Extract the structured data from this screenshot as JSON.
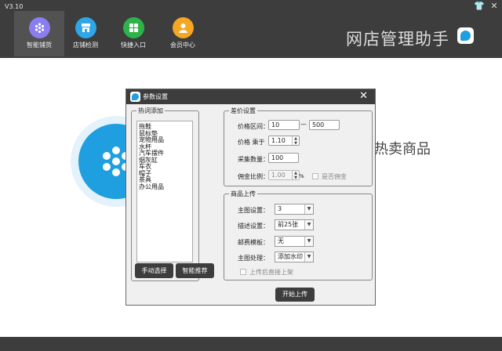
{
  "app": {
    "version": "V3.10",
    "brand_title": "网店管理助手",
    "colors": {
      "dark_bar": "#3d3d3d",
      "accent_blue": "#1f9ee0"
    }
  },
  "nav": {
    "items": [
      {
        "label": "智能铺货",
        "icon": "hexagon-dots-icon",
        "color": "#8a7df0"
      },
      {
        "label": "店铺检测",
        "icon": "store-icon",
        "color": "#2ea6e8"
      },
      {
        "label": "快捷入口",
        "icon": "grid-icon",
        "color": "#2db34a"
      },
      {
        "label": "会员中心",
        "icon": "user-icon",
        "color": "#f5a623"
      }
    ]
  },
  "background": {
    "headline": "热卖商品"
  },
  "dialog": {
    "title": "参数设置",
    "hot_words": {
      "title": "热词添加",
      "items": [
        "拖鞋",
        "鼠标垫",
        "宠物用品",
        "水杯",
        "汽车摆件",
        "烟灰缸",
        "车衣",
        "帽子",
        "茶具",
        "办公用品"
      ],
      "manual_button": "手动选择",
      "smart_button": "智能推荐"
    },
    "price": {
      "title": "差价设置",
      "range_label": "价格区间：",
      "range_min": "10",
      "range_sep": "—",
      "range_max": "500",
      "multiplier_label": "价格 乘于",
      "multiplier_value": "1.10",
      "collect_label": "采集数量：",
      "collect_value": "100",
      "commission_label": "佣金比例：",
      "commission_value": "1.00",
      "percent_sign": "%",
      "commission_check_label": "是否佣金"
    },
    "upload": {
      "title": "商品上传",
      "main_image_label": "主图设置：",
      "main_image_value": "3",
      "desc_label": "描述设置：",
      "desc_value": "前25张",
      "shipping_label": "邮费模板：",
      "shipping_value": "无",
      "image_process_label": "主图处理：",
      "image_process_value": "添加水印",
      "auto_list_label": "上传后直接上架"
    },
    "start_button": "开始上传"
  }
}
